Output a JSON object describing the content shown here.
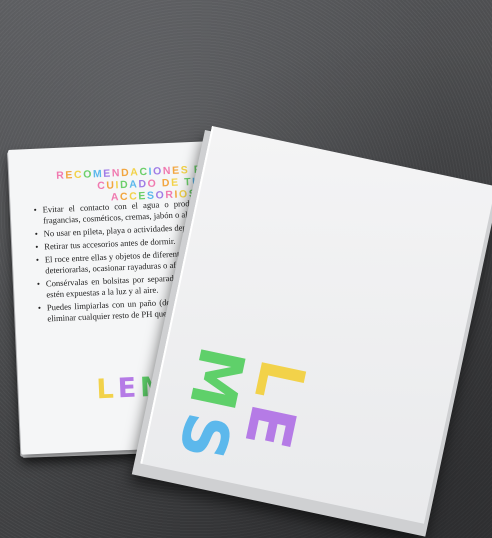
{
  "card": {
    "title_line1": "RECOMENDACIONES PARA EL",
    "title_line2": "CUIDADO DE TUS ACCESORIOS",
    "items": [
      "Evitar el contacto con el agua o productos químicos como fragancias, cosméticos, cremas, jabón o alcohol.",
      "No usar en pileta, playa o actividades deportivas.",
      "Retirar tus accesorios antes de dormir.",
      "El roce entre ellas y objetos de diferentes metales o iguales puede deteriorarlas, ocasionar rayaduras o afectar su brillo.",
      "Consérvalas en bolsitas por separado en un lugar seco, que no estén expuestas a la luz y al aire.",
      "Puedes limpiarlas con un paño (de algodón) suave y seco, para eliminar cualquier resto de PH que pueda acelerar su oxidación."
    ]
  },
  "logo": {
    "letters": [
      "L",
      "E",
      "M",
      "S"
    ],
    "colors": [
      "#f2d24a",
      "#b57be6",
      "#5fd06a",
      "#5cb8ec"
    ]
  },
  "title_colors": [
    "#f07ab0",
    "#f2a640",
    "#f2d24a",
    "#6ccf6a",
    "#5cb8ec",
    "#9f7be6"
  ]
}
